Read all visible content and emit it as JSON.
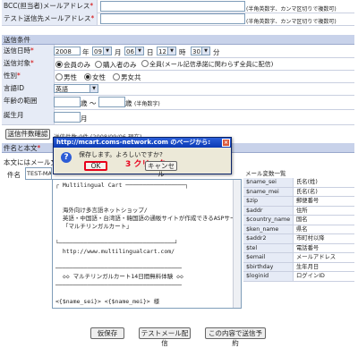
{
  "fields": {
    "bcc_label": "BCC(担当者)メールアドレス",
    "test_label": "テスト送信先メールアドレス",
    "required_mark": "*",
    "ascii_hint": "(半角英数字、カンマ区切りで複数可)"
  },
  "conditions": {
    "header": "送信条件",
    "send_datetime_label": "送信日時",
    "year": "2008",
    "year_unit": "年",
    "month": "09",
    "month_unit": "月",
    "day": "06",
    "day_unit": "日",
    "hour": "12",
    "hour_unit": "時",
    "minute": "30",
    "minute_unit": "分",
    "target_label": "送信対象",
    "target_options": [
      "会員のみ",
      "購入者のみ",
      "全員(メール記信承諾に関わらず全員に配信)"
    ],
    "gender_label": "性別",
    "gender_options": [
      "男性",
      "女性",
      "男女共"
    ],
    "language_label": "言語ID",
    "language_value": "英語",
    "age_label": "年齢の範囲",
    "age_unit": "歳",
    "age_sep": "〜",
    "age_hint": "(半角数字)",
    "birth_label": "誕生月",
    "birth_unit": "月",
    "count_button": "送信件数確認",
    "count_text": "送信件数:0件 (2008/09/06 現在)"
  },
  "mail": {
    "header": "件名と本文",
    "body_label": "本文にはメール文",
    "subject_label": "件名",
    "subject_value": "TEST-MAIL",
    "body_lines": [
      "┌ Multilingual Cart ─────────────────┐",
      "",
      "",
      "  海外向け多言語ネットショップ/",
      "  英語・中国語・台湾語・韓国語の通販サイトが作成できるASPサービス",
      "  「マルチリンガルカート」",
      "",
      "└─────────────────────────────────┘",
      "  http://www.multilingualcart.com/",
      "",
      "────────────────────────────────────",
      "  ◇◇ マルチリンガルカート14日間無料体験 ◇◇",
      "────────────────────────────────────",
      "",
      "<{$name_sei}> <{$name_mei}> 様"
    ]
  },
  "variables": {
    "header": "メール変数一覧",
    "rows": [
      {
        "key": "$name_sei",
        "value": "氏名(姓)"
      },
      {
        "key": "$name_mei",
        "value": "氏名(名)"
      },
      {
        "key": "$zip",
        "value": "郵便番号"
      },
      {
        "key": "$addr",
        "value": "住所"
      },
      {
        "key": "$country_name",
        "value": "国名"
      },
      {
        "key": "$ken_name",
        "value": "県名"
      },
      {
        "key": "$addr2",
        "value": "市町村以降"
      },
      {
        "key": "$tel",
        "value": "電話番号"
      },
      {
        "key": "$email",
        "value": "メールアドレス"
      },
      {
        "key": "$birthday",
        "value": "生年月日"
      },
      {
        "key": "$loginid",
        "value": "ログインID"
      }
    ]
  },
  "dialog": {
    "title": "http://mcart.coms-network.com のページから:",
    "message": "保存します。よろしいですか?",
    "annotation": "3 クリック",
    "ok": "OK",
    "cancel": "キャンセル",
    "close": "×",
    "icon": "?"
  },
  "buttons": {
    "save": "仮保存",
    "test_send": "テストメール配信",
    "schedule": "この内容で送信予約"
  },
  "colors": {
    "label_bg": "#e6ebf6",
    "section_bg": "#c8d2ea",
    "required": "#d40000",
    "annotation": "#e8001c",
    "dialog_title": "#0a39b4"
  }
}
